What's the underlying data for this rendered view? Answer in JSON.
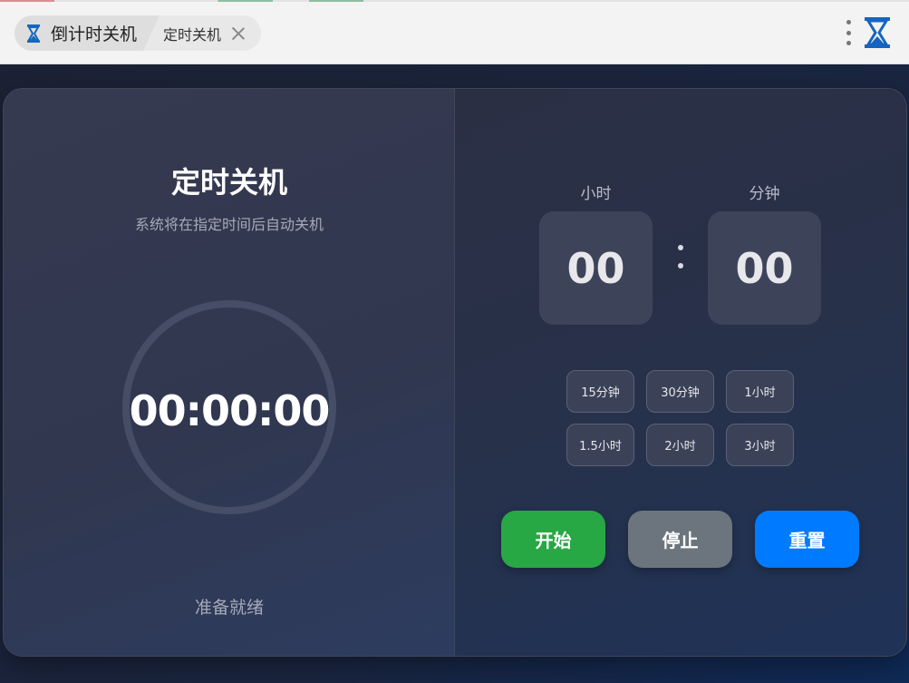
{
  "window": {
    "tab_title": "倒计时关机",
    "sub_tab_title": "定时关机"
  },
  "panel": {
    "title": "定时关机",
    "subtitle": "系统将在指定时间后自动关机",
    "countdown": "00:00:00",
    "status": "准备就绪"
  },
  "timer": {
    "hours_label": "小时",
    "minutes_label": "分钟",
    "hours_value": "00",
    "minutes_value": "00",
    "separator": ":"
  },
  "presets": [
    "15分钟",
    "30分钟",
    "1小时",
    "1.5小时",
    "2小时",
    "3小时"
  ],
  "actions": {
    "start": "开始",
    "stop": "停止",
    "reset": "重置"
  },
  "colors": {
    "start": "#28a745",
    "stop": "#6c757d",
    "reset": "#007bff",
    "accent_icon": "#1565c0"
  },
  "icons": [
    "hourglass-icon",
    "close-icon",
    "more-vertical-icon",
    "app-logo-icon"
  ]
}
